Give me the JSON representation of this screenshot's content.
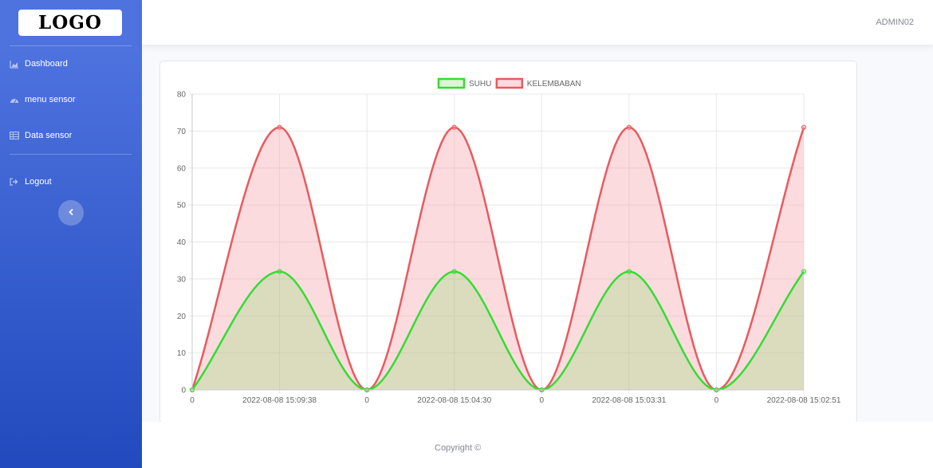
{
  "app": {
    "logo_text": "LOGO",
    "user_name": "ADMIN02",
    "copyright": "Copyright ©"
  },
  "sidebar": {
    "items": [
      {
        "label": "Dashboard",
        "icon": "chart-area-icon"
      },
      {
        "label": "menu sensor",
        "icon": "gauge-icon"
      },
      {
        "label": "Data sensor",
        "icon": "table-icon"
      },
      {
        "label": "Logout",
        "icon": "sign-out-icon"
      }
    ],
    "toggle_icon": "chevron-left-icon"
  },
  "colors": {
    "sidebar_top": "#4e73df",
    "sidebar_bottom": "#224abe",
    "suhu": "#33dd33",
    "kelembaban": "#e95a5e"
  },
  "chart_data": {
    "type": "line",
    "categories": [
      "0",
      "2022-08-08 15:09:38",
      "0",
      "2022-08-08 15:04:30",
      "0",
      "2022-08-08 15:03:31",
      "0",
      "2022-08-08 15:02:51"
    ],
    "series": [
      {
        "name": "SUHU",
        "values": [
          0,
          32,
          0,
          32,
          0,
          32,
          0,
          32
        ],
        "color": "#33dd33",
        "fill": "rgba(120,220,90,0.25)"
      },
      {
        "name": "KELEMBABAN",
        "values": [
          0,
          71,
          0,
          71,
          0,
          71,
          0,
          71
        ],
        "color": "#e95a5e",
        "fill": "rgba(246,160,170,0.38)"
      }
    ],
    "ylim": [
      0,
      80
    ],
    "yticks": [
      0,
      10,
      20,
      30,
      40,
      50,
      60,
      70,
      80
    ],
    "grid": true,
    "legend": "top-center",
    "xlabel": "",
    "ylabel": ""
  }
}
